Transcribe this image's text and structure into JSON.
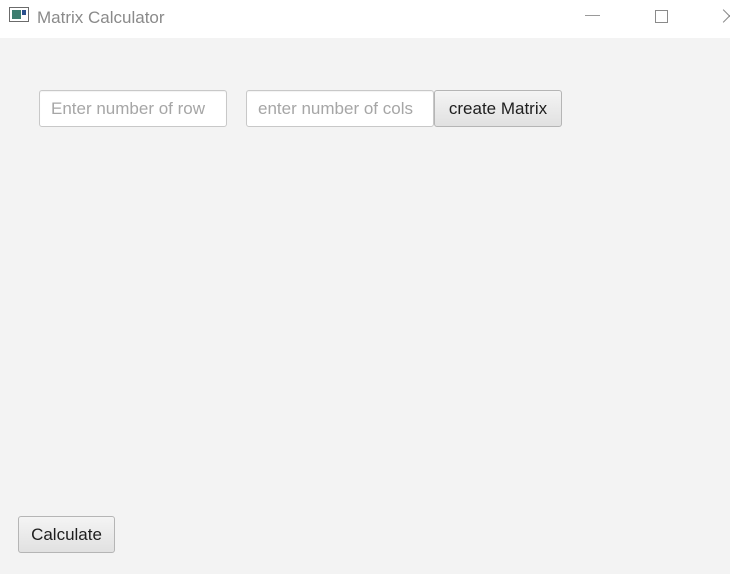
{
  "window": {
    "title": "Matrix Calculator",
    "icon": "app-window-icon"
  },
  "controls": {
    "minimize_icon": "minimize-icon",
    "maximize_icon": "maximize-icon",
    "close_icon": "close-icon"
  },
  "form": {
    "rows_placeholder": "Enter number of row",
    "rows_value": "",
    "cols_placeholder": "enter number of cols",
    "cols_value": "",
    "create_label": "create Matrix"
  },
  "footer": {
    "calculate_label": "Calculate"
  }
}
